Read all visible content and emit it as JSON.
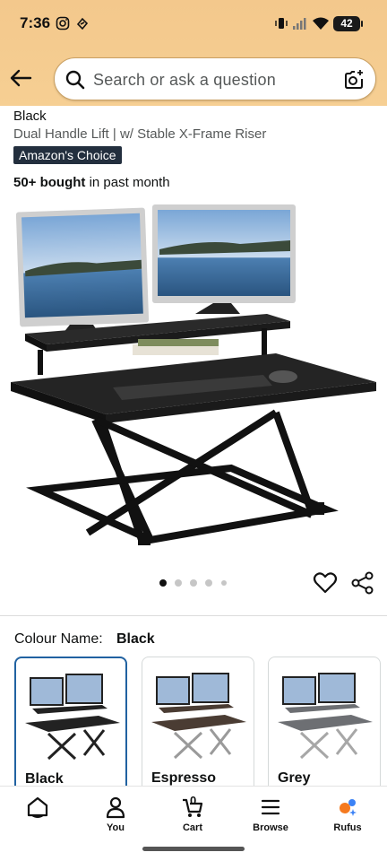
{
  "status_bar": {
    "time": "7:36",
    "battery": "42"
  },
  "search": {
    "placeholder": "Search or ask a question"
  },
  "product": {
    "title_tail": "Black",
    "subtitle": "Dual Handle Lift | w/ Stable X-Frame Riser",
    "badge": "Amazon's Choice",
    "bought_bold": "50+ bought",
    "bought_rest": " in past month",
    "image_count": 5,
    "image_index": 1
  },
  "variation": {
    "label": "Colour Name:",
    "selected": "Black",
    "options": [
      {
        "label": "Black",
        "selected": true
      },
      {
        "label": "Espresso",
        "selected": false
      },
      {
        "label": "Grey",
        "selected": false
      }
    ]
  },
  "bottom_nav": {
    "items": [
      {
        "label": "",
        "icon": "home-icon"
      },
      {
        "label": "You",
        "icon": "person-icon"
      },
      {
        "label": "Cart",
        "icon": "cart-icon",
        "count": "0"
      },
      {
        "label": "Browse",
        "icon": "menu-icon"
      },
      {
        "label": "Rufus",
        "icon": "rufus-icon"
      }
    ]
  },
  "colors": {
    "header": "#f6cf93",
    "badge": "#232f3e",
    "selected_border": "#2162a1"
  }
}
